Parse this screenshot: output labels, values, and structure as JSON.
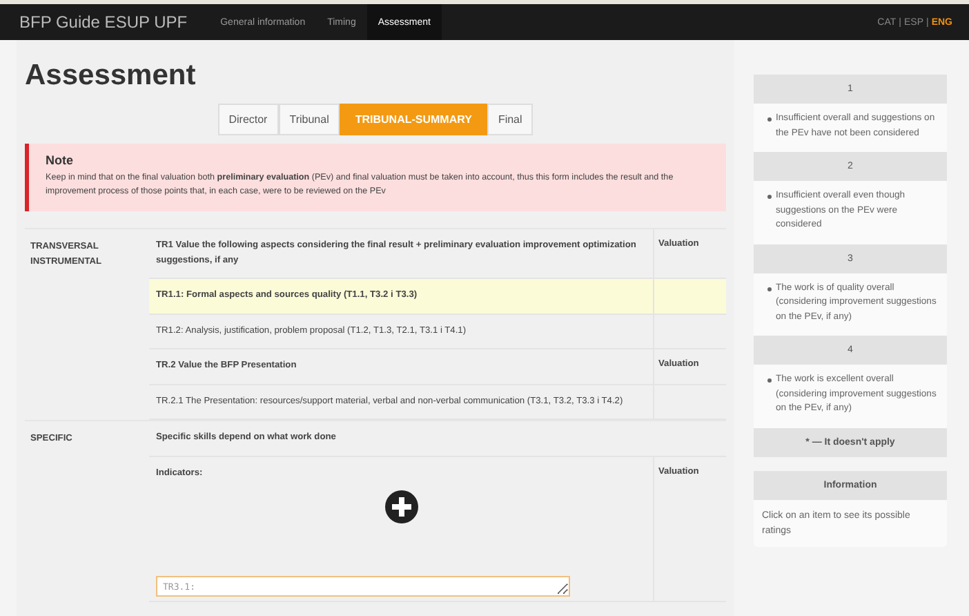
{
  "navbar": {
    "brand": "BFP Guide ESUP UPF",
    "items": [
      {
        "label": "General information",
        "selected": false
      },
      {
        "label": "Timing",
        "selected": false
      },
      {
        "label": "Assessment",
        "selected": true
      }
    ],
    "language_separator": "|",
    "languages": [
      {
        "label": "CAT",
        "selected": false
      },
      {
        "label": "ESP",
        "selected": false
      },
      {
        "label": "ENG",
        "selected": true
      }
    ]
  },
  "title": "Assessment",
  "tabs": [
    {
      "label": "Director",
      "selected": false
    },
    {
      "label": "Tribunal",
      "selected": false
    },
    {
      "label": "TRIBUNAL-SUMMARY",
      "selected": true
    },
    {
      "label": "Final",
      "selected": false
    }
  ],
  "note": {
    "title": "Note",
    "text": "Keep in mind that on the final valuation both **preliminary evaluation** (PEv) and final valuation must be taken into account, thus this form includes the result and the improvement process of those points that, in each case, were to be reviewed on the PEv"
  },
  "sections": [
    {
      "category": "TRANSVERSAL INSTRUMENTAL",
      "rows": [
        {
          "kind": "header",
          "text": "TR1 Value the following aspects considering the final result + preliminary evaluation improvement optimization suggestions, if any",
          "valuation": "Valuation"
        },
        {
          "kind": "item",
          "highlighted": true,
          "text": "TR1.1: Formal aspects and sources quality (T1.1, T3.2 i T3.3)"
        },
        {
          "kind": "item",
          "highlighted": false,
          "text": "TR1.2: Analysis, justification, problem proposal (T1.2, T1.3, T2.1, T3.1 i T4.1)"
        },
        {
          "kind": "header",
          "text": "TR.2 Value the BFP Presentation",
          "valuation": "Valuation"
        },
        {
          "kind": "item",
          "highlighted": false,
          "text": "TR.2.1 The Presentation: resources/support material, verbal and non-verbal communication (T3.1, T3.2, T3.3 i T4.2)"
        }
      ]
    },
    {
      "category": "SPECIFIC",
      "rows": [
        {
          "kind": "plain",
          "text": "Specific skills depend on what work done"
        },
        {
          "kind": "indicators",
          "text": "Indicators:",
          "valuation": "Valuation",
          "placeholder": "TR3.1:"
        }
      ]
    }
  ],
  "ratings": [
    {
      "title": "1",
      "text": "Insufficient overall and suggestions on the PEv have not been considered"
    },
    {
      "title": "2",
      "text": "Insufficient overall even though suggestions on the PEv were considered"
    },
    {
      "title": "3",
      "text": "The work is of quality overall (considering improvement suggestions on the PEv, if any)"
    },
    {
      "title": "4",
      "text": "The work is excellent overall (considering improvement suggestions on the PEv, if any)"
    }
  ],
  "not_applicable": "* — It doesn't apply",
  "info": {
    "title": "Information",
    "text": "Click on an item to see its possible ratings"
  }
}
